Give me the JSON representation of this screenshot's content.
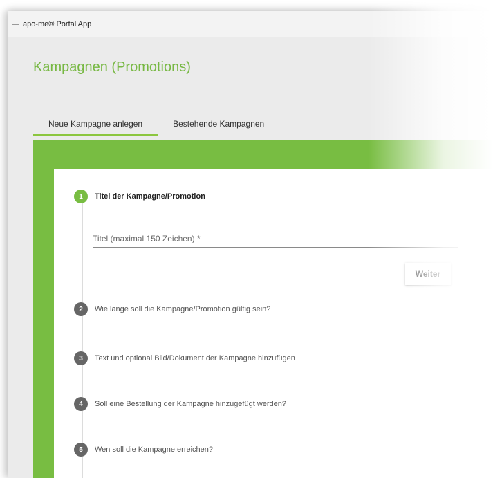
{
  "window": {
    "title": "apo-me® Portal App"
  },
  "page": {
    "title": "Kampagnen (Promotions)"
  },
  "tabs": [
    {
      "label": "Neue Kampagne anlegen",
      "active": true
    },
    {
      "label": "Bestehende Kampagnen",
      "active": false
    }
  ],
  "stepper": {
    "steps": [
      {
        "number": "1",
        "label": "Titel der Kampagne/Promotion",
        "active": true
      },
      {
        "number": "2",
        "label": "Wie lange soll die Kampagne/Promotion gültig sein?",
        "active": false
      },
      {
        "number": "3",
        "label": "Text und optional Bild/Dokument der Kampagne hinzufügen",
        "active": false
      },
      {
        "number": "4",
        "label": "Soll eine Bestellung der Kampagne hinzugefügt werden?",
        "active": false
      },
      {
        "number": "5",
        "label": "Wen soll die Kampagne erreichen?",
        "active": false
      }
    ],
    "title_field": {
      "value": "",
      "placeholder": "Titel (maximal 150 Zeichen) *"
    },
    "next_label": "Weiter"
  },
  "colors": {
    "accent": "#78bd42",
    "title": "#77b843",
    "inactive_step": "#666666"
  }
}
